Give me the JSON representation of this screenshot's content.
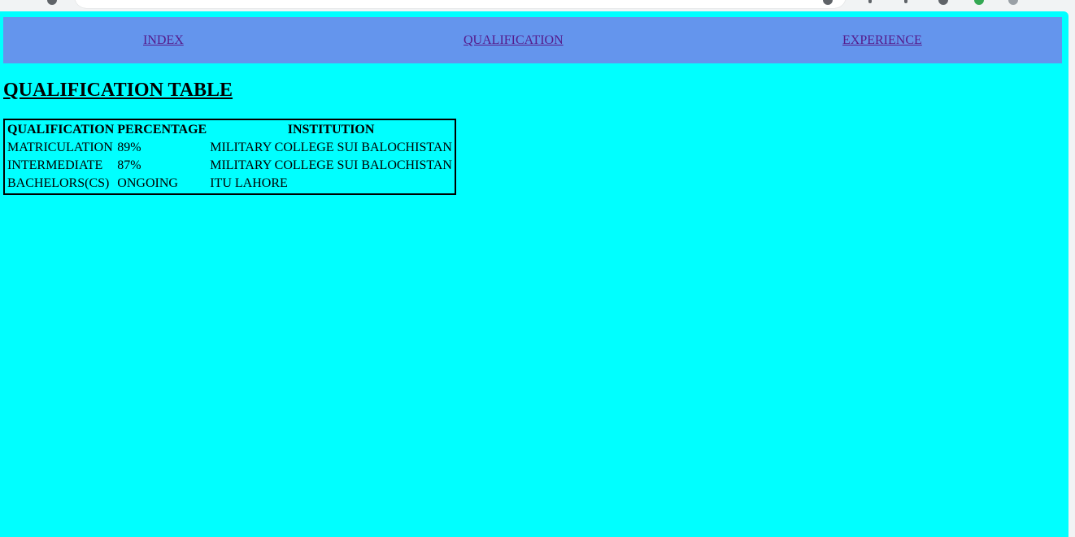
{
  "nav": {
    "links": [
      {
        "label": "INDEX"
      },
      {
        "label": "QUALIFICATION"
      },
      {
        "label": "EXPERIENCE"
      }
    ]
  },
  "page": {
    "title": "QUALIFICATION TABLE"
  },
  "table": {
    "headers": [
      "QUALIFICATION",
      "PERCENTAGE",
      "INSTITUTION"
    ],
    "rows": [
      [
        "MATRICULATION",
        "89%",
        "MILITARY COLLEGE SUI BALOCHISTAN"
      ],
      [
        "INTERMEDIATE",
        "87%",
        "MILITARY COLLEGE SUI BALOCHISTAN"
      ],
      [
        "BACHELORS(CS)",
        "ONGOING",
        "ITU LAHORE"
      ]
    ]
  },
  "colors": {
    "page_background": "#00ffff",
    "navbar_background": "#6495ed",
    "link": "#551a8b"
  }
}
